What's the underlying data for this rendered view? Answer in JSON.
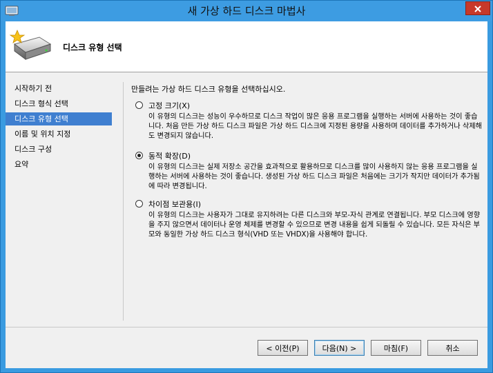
{
  "window": {
    "title": "새 가상 하드 디스크 마법사"
  },
  "icons": {
    "app": "virtual-disk-icon",
    "wizard": "hard-disk-star-icon",
    "close": "close-icon"
  },
  "header": {
    "title": "디스크 유형 선택"
  },
  "sidebar": {
    "items": [
      {
        "label": "시작하기 전",
        "active": false
      },
      {
        "label": "디스크 형식 선택",
        "active": false
      },
      {
        "label": "디스크 유형 선택",
        "active": true
      },
      {
        "label": "이름 및 위치 지정",
        "active": false
      },
      {
        "label": "디스크 구성",
        "active": false
      },
      {
        "label": "요약",
        "active": false
      }
    ]
  },
  "main": {
    "instruction": "만들려는 가상 하드 디스크 유형을 선택하십시오.",
    "options": [
      {
        "label": "고정 크기(X)",
        "checked": false,
        "description": "이 유형의 디스크는 성능이 우수하므로 디스크 작업이 많은 응용 프로그램을 실행하는 서버에 사용하는 것이 좋습니다. 처음 만든 가상 하드 디스크 파일은 가상 하드 디스크에 지정된 용량을 사용하며 데이터를 추가하거나 삭제해도 변경되지 않습니다."
      },
      {
        "label": "동적 확장(D)",
        "checked": true,
        "description": "이 유형의 디스크는 실제 저장소 공간을 효과적으로 활용하므로 디스크를 많이 사용하지 않는 응용 프로그램을 실행하는 서버에 사용하는 것이 좋습니다. 생성된 가상 하드 디스크 파일은 처음에는 크기가 작지만 데이터가 추가됨에 따라 변경됩니다."
      },
      {
        "label": "차이점 보관용(I)",
        "checked": false,
        "description": "이 유형의 디스크는 사용자가 그대로 유지하려는 다른 디스크와 부모-자식 관계로 연결됩니다. 부모 디스크에 영향을 주지 않으면서 데이터나 운영 체제를 변경할 수 있으므로 변경 내용을 쉽게 되돌릴 수 있습니다. 모든 자식은 부모와 동일한 가상 하드 디스크 형식(VHD 또는 VHDX)을 사용해야 합니다."
      }
    ]
  },
  "footer": {
    "previous": "< 이전(P)",
    "next": "다음(N) >",
    "finish": "마침(F)",
    "cancel": "취소"
  },
  "colors": {
    "titlebar": "#3D9CE2",
    "close_button": "#C7392A",
    "selection": "#3F7FD0",
    "client": "#F0F0F0"
  }
}
